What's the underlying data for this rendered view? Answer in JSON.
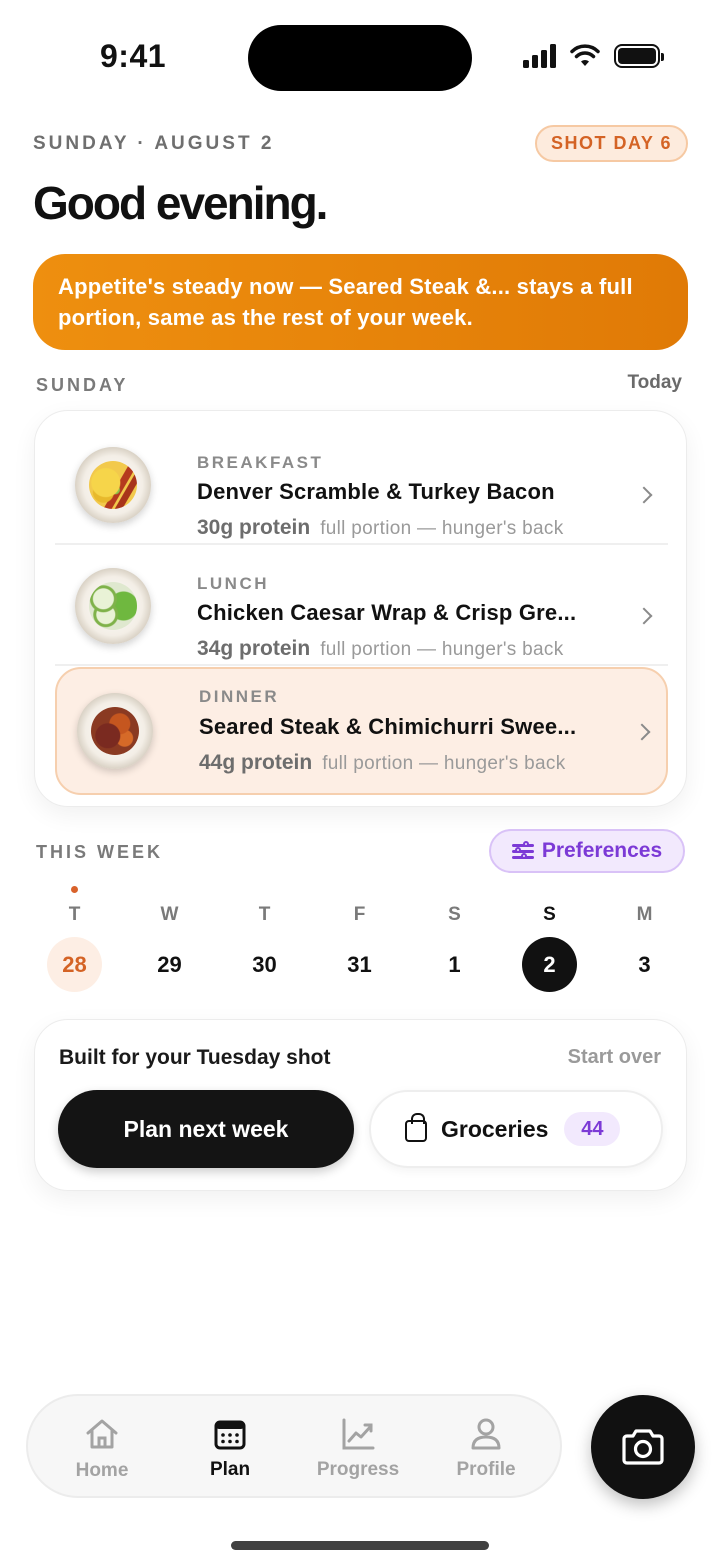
{
  "status": {
    "time": "9:41"
  },
  "header": {
    "date": "SUNDAY · AUGUST 2",
    "shot_badge": "SHOT DAY 6",
    "greeting": "Good evening."
  },
  "banner": {
    "text": "Appetite's steady now — Seared Steak &... stays a full portion, same as the rest of your week.",
    "color": "#E8870A"
  },
  "day": {
    "label": "SUNDAY",
    "right_label": "Today",
    "meals": [
      {
        "kicker": "BREAKFAST",
        "title": "Denver Scramble & Turkey Bacon",
        "protein": "30g protein",
        "note": "full portion — hunger's back",
        "highlighted": false
      },
      {
        "kicker": "LUNCH",
        "title": "Chicken Caesar Wrap & Crisp Gre...",
        "protein": "34g protein",
        "note": "full portion — hunger's back",
        "highlighted": false
      },
      {
        "kicker": "DINNER",
        "title": "Seared Steak & Chimichurri Swee...",
        "protein": "44g protein",
        "note": "full portion — hunger's back",
        "highlighted": true
      }
    ]
  },
  "week": {
    "label": "THIS WEEK",
    "preferences_label": "Preferences",
    "days": [
      {
        "weekday": "T",
        "date": "28",
        "state": "shot-day"
      },
      {
        "weekday": "W",
        "date": "29",
        "state": "normal"
      },
      {
        "weekday": "T",
        "date": "30",
        "state": "normal"
      },
      {
        "weekday": "F",
        "date": "31",
        "state": "normal"
      },
      {
        "weekday": "S",
        "date": "1",
        "state": "normal"
      },
      {
        "weekday": "S",
        "date": "2",
        "state": "selected"
      },
      {
        "weekday": "M",
        "date": "3",
        "state": "normal"
      }
    ]
  },
  "actions": {
    "built_for": "Built for your Tuesday shot",
    "start_over": "Start over",
    "plan_next": "Plan next week",
    "groceries_label": "Groceries",
    "groceries_count": "44"
  },
  "tabs": [
    {
      "label": "Home",
      "icon": "home-icon",
      "active": false
    },
    {
      "label": "Plan",
      "icon": "calendar-icon",
      "active": true
    },
    {
      "label": "Progress",
      "icon": "chart-icon",
      "active": false
    },
    {
      "label": "Profile",
      "icon": "person-icon",
      "active": false
    }
  ],
  "colors": {
    "accent_orange": "#D46325",
    "accent_purple": "#7C3AD6",
    "dark": "#111111"
  }
}
